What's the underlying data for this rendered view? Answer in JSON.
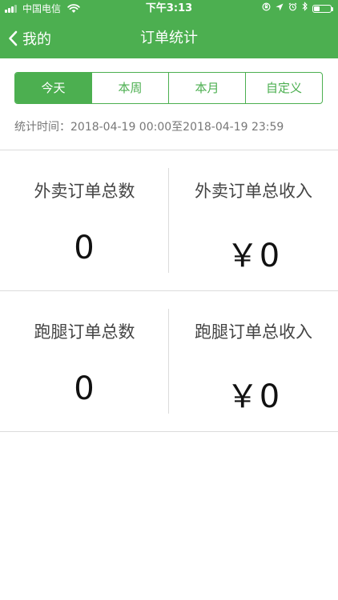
{
  "status_bar": {
    "carrier": "中国电信",
    "time": "下午3:13"
  },
  "nav": {
    "back_label": "我的",
    "title": "订单统计"
  },
  "tabs": [
    {
      "label": "今天",
      "active": true
    },
    {
      "label": "本周",
      "active": false
    },
    {
      "label": "本月",
      "active": false
    },
    {
      "label": "自定义",
      "active": false
    }
  ],
  "stat_period": {
    "text": "统计时间：2018-04-19 00:00至2018-04-19 23:59"
  },
  "stats": {
    "takeout_count": {
      "label": "外卖订单总数",
      "value": "0"
    },
    "takeout_income": {
      "label": "外卖订单总收入",
      "value": "￥0"
    },
    "errand_count": {
      "label": "跑腿订单总数",
      "value": "0"
    },
    "errand_income": {
      "label": "跑腿订单总收入",
      "value": "￥0"
    }
  },
  "colors": {
    "brand": "#4caf50",
    "divider": "#dcdcdc"
  }
}
